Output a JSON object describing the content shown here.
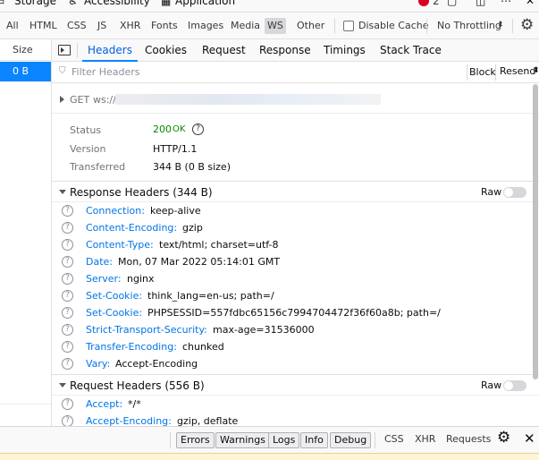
{
  "topbar": {
    "storage": "Storage",
    "accessibility": "Accessibility",
    "application": "Application",
    "error_count": "2"
  },
  "filters": {
    "types": [
      "All",
      "HTML",
      "CSS",
      "JS",
      "XHR",
      "Fonts",
      "Images",
      "Media",
      "WS",
      "Other"
    ],
    "active": "WS",
    "disable_cache": "Disable Cache",
    "throttling": "No Throttling"
  },
  "list": {
    "column": "Size",
    "selected_size": "0 B"
  },
  "detail": {
    "tabs": [
      "Headers",
      "Cookies",
      "Request",
      "Response",
      "Timings",
      "Stack Trace"
    ],
    "active_tab": "Headers",
    "filter_placeholder": "Filter Headers",
    "block": "Block",
    "resend": "Resend",
    "method": "GET",
    "url_prefix": "ws://",
    "summary": {
      "status_label": "Status",
      "status_code": "200",
      "status_text": "OK",
      "version_label": "Version",
      "version": "HTTP/1.1",
      "transferred_label": "Transferred",
      "transferred": "344 B (0 B size)"
    },
    "response_headers_title": "Response Headers (344 B)",
    "raw": "Raw",
    "response_headers": [
      {
        "name": "Connection:",
        "value": "keep-alive"
      },
      {
        "name": "Content-Encoding:",
        "value": "gzip"
      },
      {
        "name": "Content-Type:",
        "value": "text/html; charset=utf-8"
      },
      {
        "name": "Date:",
        "value": "Mon, 07 Mar 2022 05:14:01 GMT"
      },
      {
        "name": "Server:",
        "value": "nginx"
      },
      {
        "name": "Set-Cookie:",
        "value": "think_lang=en-us; path=/"
      },
      {
        "name": "Set-Cookie:",
        "value": "PHPSESSID=557fdbc65156c7994704472f36f60a8b; path=/"
      },
      {
        "name": "Strict-Transport-Security:",
        "value": "max-age=31536000"
      },
      {
        "name": "Transfer-Encoding:",
        "value": "chunked"
      },
      {
        "name": "Vary:",
        "value": "Accept-Encoding"
      }
    ],
    "request_headers_title": "Request Headers (556 B)",
    "request_headers": [
      {
        "name": "Accept:",
        "value": "*/*"
      },
      {
        "name": "Accept-Encoding:",
        "value": "gzip, deflate"
      }
    ]
  },
  "console": {
    "buttons": [
      "Errors",
      "Warnings",
      "Logs",
      "Info",
      "Debug"
    ],
    "others": [
      "CSS",
      "XHR",
      "Requests"
    ]
  }
}
